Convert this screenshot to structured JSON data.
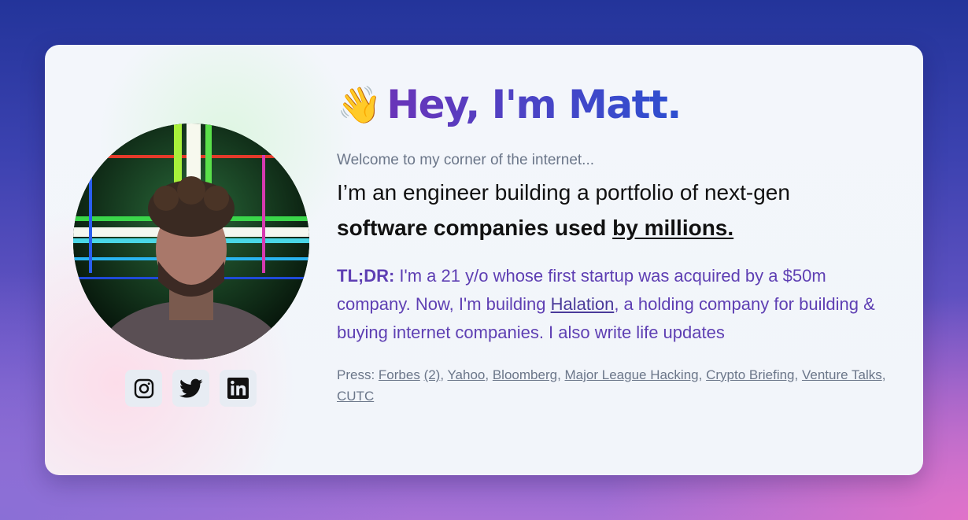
{
  "hero": {
    "wave_emoji": "👋",
    "title": "Hey, I'm Matt.",
    "welcome": "Welcome to my corner of the internet...",
    "intro_text": "I’m an engineer building a portfolio of next-gen",
    "intro_bold": "software companies used",
    "intro_link": "by millions."
  },
  "tldr": {
    "label": "TL;DR:",
    "text_before": " I'm a 21 y/o whose first startup was acquired by a $50m company. Now, I'm building ",
    "link": "Halation",
    "text_after": ", a holding company for building & buying internet companies. I also write life updates"
  },
  "press": {
    "label": "Press: ",
    "links": [
      "Forbes",
      "(2)",
      "Yahoo",
      "Bloomberg",
      "Major League Hacking",
      "Crypto Briefing",
      "Venture Talks",
      "CUTC"
    ]
  },
  "socials": {
    "icons": [
      "instagram-icon",
      "twitter-icon",
      "linkedin-icon"
    ]
  },
  "colors": {
    "accent_purple": "#5e3fb3",
    "title_gradient_start": "#6a34b8",
    "title_gradient_end": "#2d4fd0",
    "muted_text": "#6b7689"
  }
}
